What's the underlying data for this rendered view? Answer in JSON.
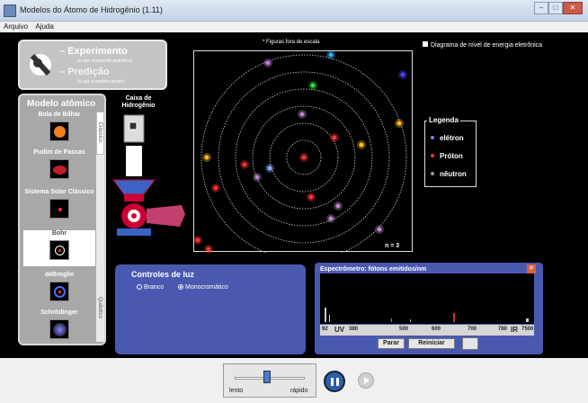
{
  "window": {
    "title": "Modelos do Átomo de Hidrogênio (1.11)"
  },
  "menu": [
    "Arquivo",
    "Ajuda"
  ],
  "mode": {
    "experiment": "Experimento",
    "experiment_sub": "(o que realmente acontece)",
    "prediction": "Predição",
    "prediction_sub": "(o que o modelo prediz)",
    "selected": "Predição"
  },
  "model_panel": {
    "title": "Modelo atômico",
    "items": [
      "Bola de Bilhar",
      "Pudim de Passas",
      "Sistema Solar Clássico",
      "Bohr",
      "deBroglie",
      "Schrödinger"
    ],
    "selected": "Bohr",
    "classic_label": "Clássico",
    "quantum_label": "Quântico"
  },
  "box_label": "Caixa de Hidrogênio",
  "view": {
    "caption": "* Figuras fora de escala",
    "n_label": "n = 3",
    "orbit_count": 6,
    "current_orbit": 3
  },
  "energy_diagram": "Diagrama de nível de energia eletrônica",
  "legend": {
    "title": "Legenda",
    "items": [
      {
        "label": "elétron",
        "color": "#7a7cff"
      },
      {
        "label": "Próton",
        "color": "#ff3030"
      },
      {
        "label": "nêutron",
        "color": "#9a9a9a"
      }
    ]
  },
  "light_controls": {
    "title": "Controles de luz",
    "white": "Branco",
    "mono": "Monocromático",
    "selected": "Monocromático"
  },
  "spectrometer": {
    "title": "Espectrômetro: fótons emitidos/nm",
    "ticks": [
      "92",
      "UV",
      "380",
      "500",
      "600",
      "700",
      "780",
      "IR",
      "7500"
    ],
    "reset": "Parar",
    "restart": "Reiniciar"
  },
  "speed": {
    "slow": "lento",
    "fast": "rápido",
    "value": 0.45
  },
  "colors": {
    "panel_blue": "#4a59b0",
    "sim_bg": "#000000"
  }
}
